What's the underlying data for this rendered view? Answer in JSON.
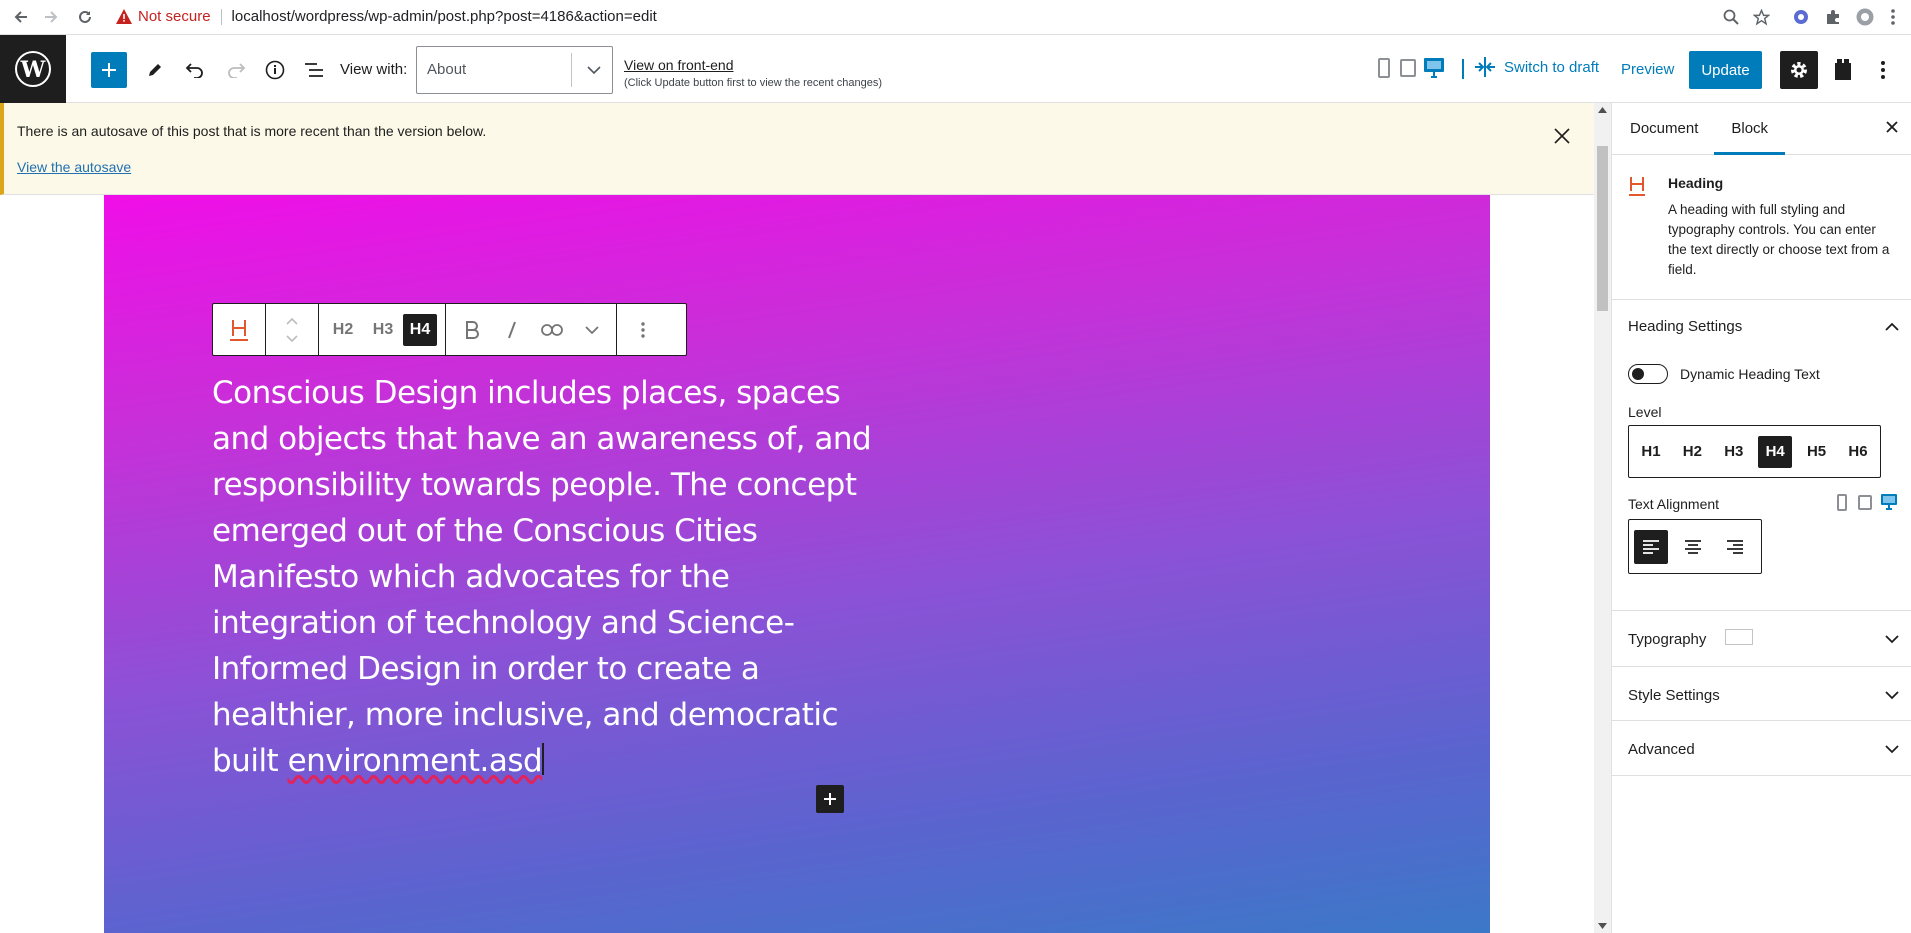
{
  "browser": {
    "security_label": "Not secure",
    "url": "localhost/wordpress/wp-admin/post.php?post=4186&action=edit"
  },
  "toolbar": {
    "view_with_label": "View with:",
    "view_with_value": "About",
    "view_front_end_label": "View on front-end",
    "view_front_end_note": "(Click Update button first to view the recent changes)",
    "switch_draft_label": "Switch to draft",
    "preview_label": "Preview",
    "update_label": "Update"
  },
  "notice": {
    "message": "There is an autosave of this post that is more recent than the version below.",
    "link_label": "View the autosave"
  },
  "block_toolbar": {
    "levels": [
      "H2",
      "H3",
      "H4"
    ],
    "active_level": "H4"
  },
  "content": {
    "heading_text_before": "Conscious Design includes places, spaces and objects that have an awareness of, and responsibility towards people. The concept emerged out of the Conscious Cities Manifesto which advocates for the integration of technology and Science-Informed Design in order to create a healthier, more inclusive, and democratic built ",
    "heading_text_misspelled": "environment.asd"
  },
  "sidebar": {
    "tabs": [
      "Document",
      "Block"
    ],
    "active_tab": "Block",
    "block_card": {
      "title": "Heading",
      "description": "A heading with full styling and typography controls. You can enter the text directly or choose text from a field."
    },
    "heading_settings": {
      "title": "Heading Settings",
      "toggle_label": "Dynamic Heading Text",
      "toggle_on": false,
      "level_label": "Level",
      "levels": [
        "H1",
        "H2",
        "H3",
        "H4",
        "H5",
        "H6"
      ],
      "active_level": "H4",
      "alignment_label": "Text Alignment",
      "active_alignment": "left"
    },
    "panels": {
      "typography": "Typography",
      "style_settings": "Style Settings",
      "advanced": "Advanced"
    }
  },
  "colors": {
    "accent": "#007cba",
    "dark": "#1e1e1e",
    "notice_border": "#dba617",
    "heading_icon": "#e2572b",
    "gradient_start": "#f00ee8",
    "gradient_end": "#3c78c8"
  }
}
